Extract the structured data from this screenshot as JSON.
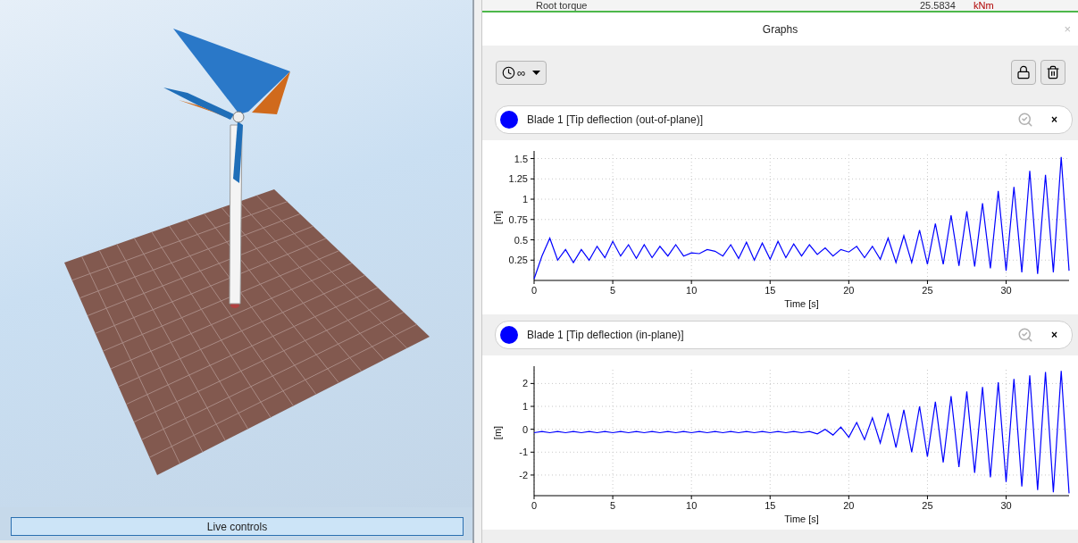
{
  "viewport": {
    "live_controls_button": "Live controls"
  },
  "table_row": {
    "name": "Root torque",
    "value": "25.5834",
    "unit": "kNm"
  },
  "graphs_panel": {
    "title": "Graphs",
    "close": "×",
    "toolbar": {
      "time_window": "∞"
    },
    "graphs": [
      {
        "legend": {
          "label": "Blade 1 [Tip deflection (out-of-plane)]",
          "color": "#0000ff",
          "close": "×"
        },
        "chart_data": {
          "type": "line",
          "grid": true,
          "xlabel": "Time [s]",
          "ylabel": "[m]",
          "xlim": [
            0,
            34
          ],
          "ylim": [
            0,
            1.55
          ],
          "xticks": [
            0,
            5,
            10,
            15,
            20,
            25,
            30
          ],
          "yticks": [
            0.25,
            0.5,
            0.75,
            1,
            1.25,
            1.5
          ],
          "x": [
            0,
            0.5,
            1,
            1.5,
            2,
            2.5,
            3,
            3.5,
            4,
            4.5,
            5,
            5.5,
            6,
            6.5,
            7,
            7.5,
            8,
            8.5,
            9,
            9.5,
            10,
            10.5,
            11,
            11.5,
            12,
            12.5,
            13,
            13.5,
            14,
            14.5,
            15,
            15.5,
            16,
            16.5,
            17,
            17.5,
            18,
            18.5,
            19,
            19.5,
            20,
            20.5,
            21,
            21.5,
            22,
            22.5,
            23,
            23.5,
            24,
            24.5,
            25,
            25.5,
            26,
            26.5,
            27,
            27.5,
            28,
            28.5,
            29,
            29.5,
            30,
            30.5,
            31,
            31.5,
            32,
            32.5,
            33,
            33.5,
            34
          ],
          "series": [
            {
              "color": "#0000ff",
              "values": [
                0.02,
                0.3,
                0.52,
                0.25,
                0.38,
                0.22,
                0.38,
                0.25,
                0.42,
                0.28,
                0.48,
                0.3,
                0.44,
                0.27,
                0.44,
                0.28,
                0.42,
                0.3,
                0.44,
                0.3,
                0.34,
                0.33,
                0.38,
                0.36,
                0.3,
                0.44,
                0.27,
                0.47,
                0.25,
                0.46,
                0.26,
                0.48,
                0.28,
                0.45,
                0.3,
                0.44,
                0.32,
                0.4,
                0.3,
                0.38,
                0.35,
                0.42,
                0.28,
                0.42,
                0.26,
                0.52,
                0.22,
                0.55,
                0.22,
                0.62,
                0.2,
                0.7,
                0.2,
                0.8,
                0.18,
                0.85,
                0.17,
                0.95,
                0.15,
                1.1,
                0.12,
                1.15,
                0.1,
                1.35,
                0.08,
                1.3,
                0.1,
                1.52,
                0.12
              ]
            }
          ]
        }
      },
      {
        "legend": {
          "label": "Blade 1 [Tip deflection (in-plane)]",
          "color": "#0000ff",
          "close": "×"
        },
        "chart_data": {
          "type": "line",
          "grid": true,
          "xlabel": "Time [s]",
          "ylabel": "[m]",
          "xlim": [
            0,
            34
          ],
          "ylim": [
            -2.9,
            2.6
          ],
          "xticks": [
            0,
            5,
            10,
            15,
            20,
            25,
            30
          ],
          "yticks": [
            -2,
            -1,
            0,
            1,
            2
          ],
          "x": [
            0,
            0.5,
            1,
            1.5,
            2,
            2.5,
            3,
            3.5,
            4,
            4.5,
            5,
            5.5,
            6,
            6.5,
            7,
            7.5,
            8,
            8.5,
            9,
            9.5,
            10,
            10.5,
            11,
            11.5,
            12,
            12.5,
            13,
            13.5,
            14,
            14.5,
            15,
            15.5,
            16,
            16.5,
            17,
            17.5,
            18,
            18.5,
            19,
            19.5,
            20,
            20.5,
            21,
            21.5,
            22,
            22.5,
            23,
            23.5,
            24,
            24.5,
            25,
            25.5,
            26,
            26.5,
            27,
            27.5,
            28,
            28.5,
            29,
            29.5,
            30,
            30.5,
            31,
            31.5,
            32,
            32.5,
            33,
            33.5,
            34
          ],
          "series": [
            {
              "color": "#0000ff",
              "values": [
                -0.15,
                -0.1,
                -0.15,
                -0.1,
                -0.15,
                -0.1,
                -0.15,
                -0.1,
                -0.15,
                -0.1,
                -0.15,
                -0.1,
                -0.15,
                -0.1,
                -0.15,
                -0.1,
                -0.15,
                -0.1,
                -0.15,
                -0.1,
                -0.15,
                -0.1,
                -0.15,
                -0.1,
                -0.15,
                -0.1,
                -0.15,
                -0.1,
                -0.15,
                -0.1,
                -0.15,
                -0.1,
                -0.15,
                -0.1,
                -0.15,
                -0.1,
                -0.2,
                0,
                -0.25,
                0.1,
                -0.35,
                0.3,
                -0.45,
                0.5,
                -0.6,
                0.7,
                -0.8,
                0.85,
                -1,
                1,
                -1.2,
                1.2,
                -1.45,
                1.45,
                -1.65,
                1.65,
                -1.9,
                1.85,
                -2.1,
                2.05,
                -2.3,
                2.2,
                -2.5,
                2.35,
                -2.65,
                2.5,
                -2.75,
                2.55,
                -2.8
              ]
            }
          ]
        }
      }
    ]
  }
}
